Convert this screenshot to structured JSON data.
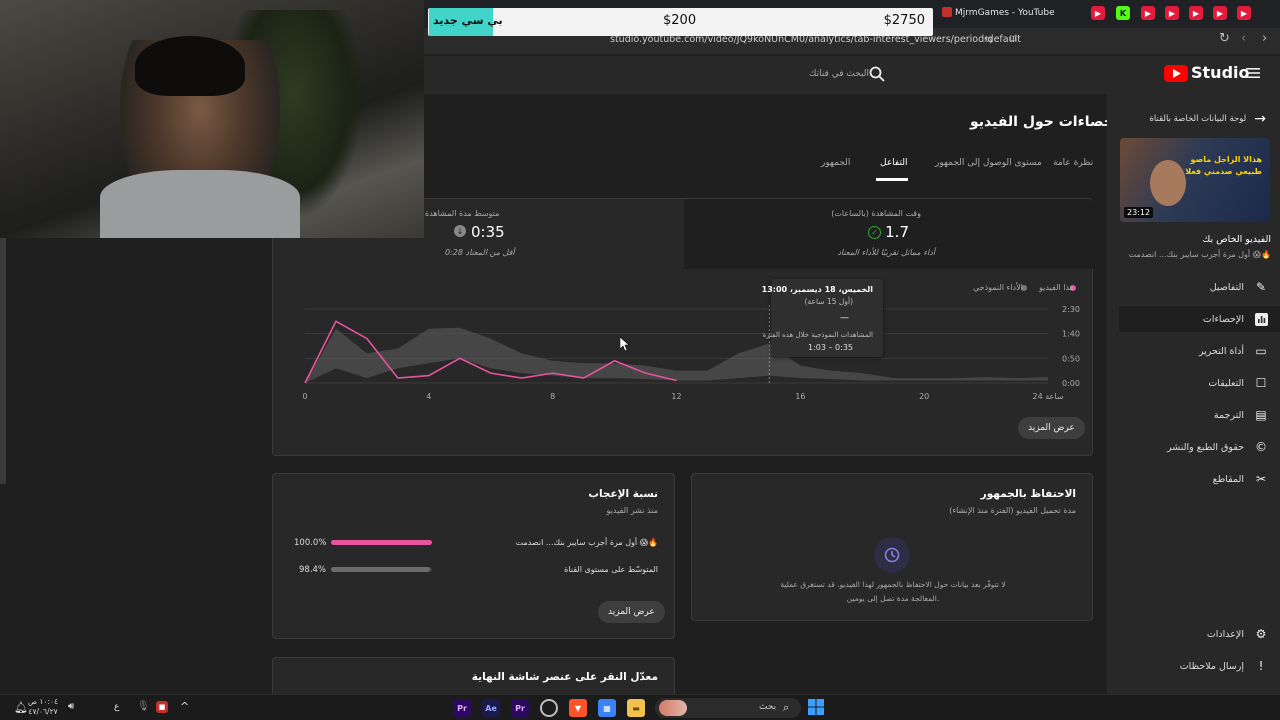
{
  "browser": {
    "tab_title": "MjrmGames - YouTube",
    "url": "studio.youtube.com/video/JQ9koNUnCM0/analytics/tab-interest_viewers/period-default"
  },
  "stream_overlay": {
    "label": "بي سي جديد",
    "amount_left": "$200",
    "amount_right": "$2750"
  },
  "studio": {
    "brand": "Studio",
    "search_placeholder": "البحث في قناتك",
    "back_label": "لوحة البيانات الخاصة بالقناة",
    "video": {
      "duration": "23:12",
      "thumb_caption": "هذالا الراجل ماصو طبيعي صدمني فعلا",
      "heading": "الفيديو الخاص بك",
      "title": "أول مرة أجرب سايبر بنك... انصدمت 😱🔥"
    },
    "nav": [
      {
        "label": "التفاصيل",
        "icon": "pencil-icon"
      },
      {
        "label": "الإحصاءات",
        "icon": "analytics-icon"
      },
      {
        "label": "أداة التحرير",
        "icon": "editor-icon"
      },
      {
        "label": "التعليقات",
        "icon": "comments-icon"
      },
      {
        "label": "الترجمة",
        "icon": "subtitles-icon"
      },
      {
        "label": "حقوق الطبع والنشر",
        "icon": "copyright-icon"
      },
      {
        "label": "المقاطع",
        "icon": "scissors-icon"
      }
    ],
    "settings_label": "الإعدادات",
    "feedback_label": "إرسال ملاحظات"
  },
  "analytics": {
    "page_title": "إحصاءات حول الفيديو",
    "tabs": [
      "نظرة عامة",
      "مستوى الوصول إلى الجمهور",
      "التفاعل",
      "الجمهور"
    ],
    "active_tab": "التفاعل",
    "metric_watch": {
      "label": "وقت المشاهدة (بالساعات)",
      "value": "1.7",
      "note": "أداء مماثل تقريبًا للأداء المعتاد"
    },
    "metric_avg": {
      "label": "متوسط مدة المشاهدة",
      "value": "0:35",
      "note": "0:28 أقل من المعتاد"
    },
    "legend_this": "هذا الفيديو",
    "legend_typical": "الأداء النموذجي",
    "tooltip": {
      "date": "الخميس، 18 ديسمبر، 13:00",
      "sub": "(أول 15 ساعة)",
      "value": "—",
      "typical_label": "المشاهدات النموذجية خلال هذه الفترة",
      "typical_range": "1:03 – 0:35"
    },
    "see_more": "عرض المزيد"
  },
  "chart_data": {
    "type": "line",
    "x_ticks": [
      "0",
      "4",
      "8",
      "12",
      "16",
      "20",
      "24 ساعة"
    ],
    "y_ticks": [
      "0:00",
      "0:50",
      "1:40",
      "2:30"
    ],
    "series": [
      {
        "name": "هذا الفيديو",
        "color": "#e8539d",
        "x": [
          0,
          1,
          2,
          3,
          4,
          5,
          6,
          7,
          8,
          9,
          10,
          11,
          12
        ],
        "y_seconds": [
          0,
          125,
          90,
          10,
          15,
          50,
          20,
          10,
          20,
          10,
          45,
          20,
          5
        ]
      },
      {
        "name": "الأداء النموذجي",
        "color": "#5e5e5e",
        "x": [
          0,
          1,
          2,
          3,
          4,
          5,
          6,
          7,
          8,
          9,
          10,
          11,
          12,
          13,
          14,
          15,
          16,
          17,
          18,
          19,
          20,
          21,
          22,
          23,
          24
        ],
        "low_seconds": [
          0,
          30,
          10,
          30,
          40,
          50,
          30,
          20,
          15,
          10,
          10,
          8,
          5,
          5,
          10,
          15,
          10,
          8,
          5,
          5,
          5,
          5,
          5,
          5,
          5
        ],
        "high_seconds": [
          0,
          110,
          60,
          70,
          110,
          112,
          90,
          60,
          45,
          40,
          40,
          35,
          25,
          25,
          60,
          80,
          35,
          25,
          20,
          10,
          10,
          10,
          12,
          10,
          12
        ]
      }
    ],
    "ylim_seconds": [
      0,
      150
    ]
  },
  "retention_card": {
    "title": "الاحتفاظ بالجمهور",
    "subtitle": "مدة تحميل الفيديو (الفترة منذ الإنشاء)",
    "message": "لا تتوفّر بعد بيانات حول الاحتفاظ بالجمهور لهذا الفيديو. قد تستغرق عملية المعالجة مدة تصل إلى يومين."
  },
  "likes_card": {
    "title": "نسبة الإعجاب",
    "subtitle": "منذ نشر الفيديو",
    "rows": [
      {
        "label": "أول مرة أجرب سايبر بنك... انصدمت 😱🔥",
        "value": "100.0%",
        "fill": 1.0,
        "color": "#e8539d"
      },
      {
        "label": "المتوسّط على مستوى القناة",
        "value": "98.4%",
        "fill": 0.984,
        "color": "#6b6b6b"
      }
    ],
    "see_more": "عرض المزيد"
  },
  "endscreen_card": {
    "title": "معدّل النقر على عنصر شاشة النهاية"
  },
  "taskbar": {
    "search_label": "بحث",
    "apps": [
      "Pr",
      "Ae",
      "Pr"
    ],
    "clock_time": "١٠:٠٤ ص",
    "clock_date": "٤٧/٠٦/٢٧",
    "lang": "ع"
  }
}
